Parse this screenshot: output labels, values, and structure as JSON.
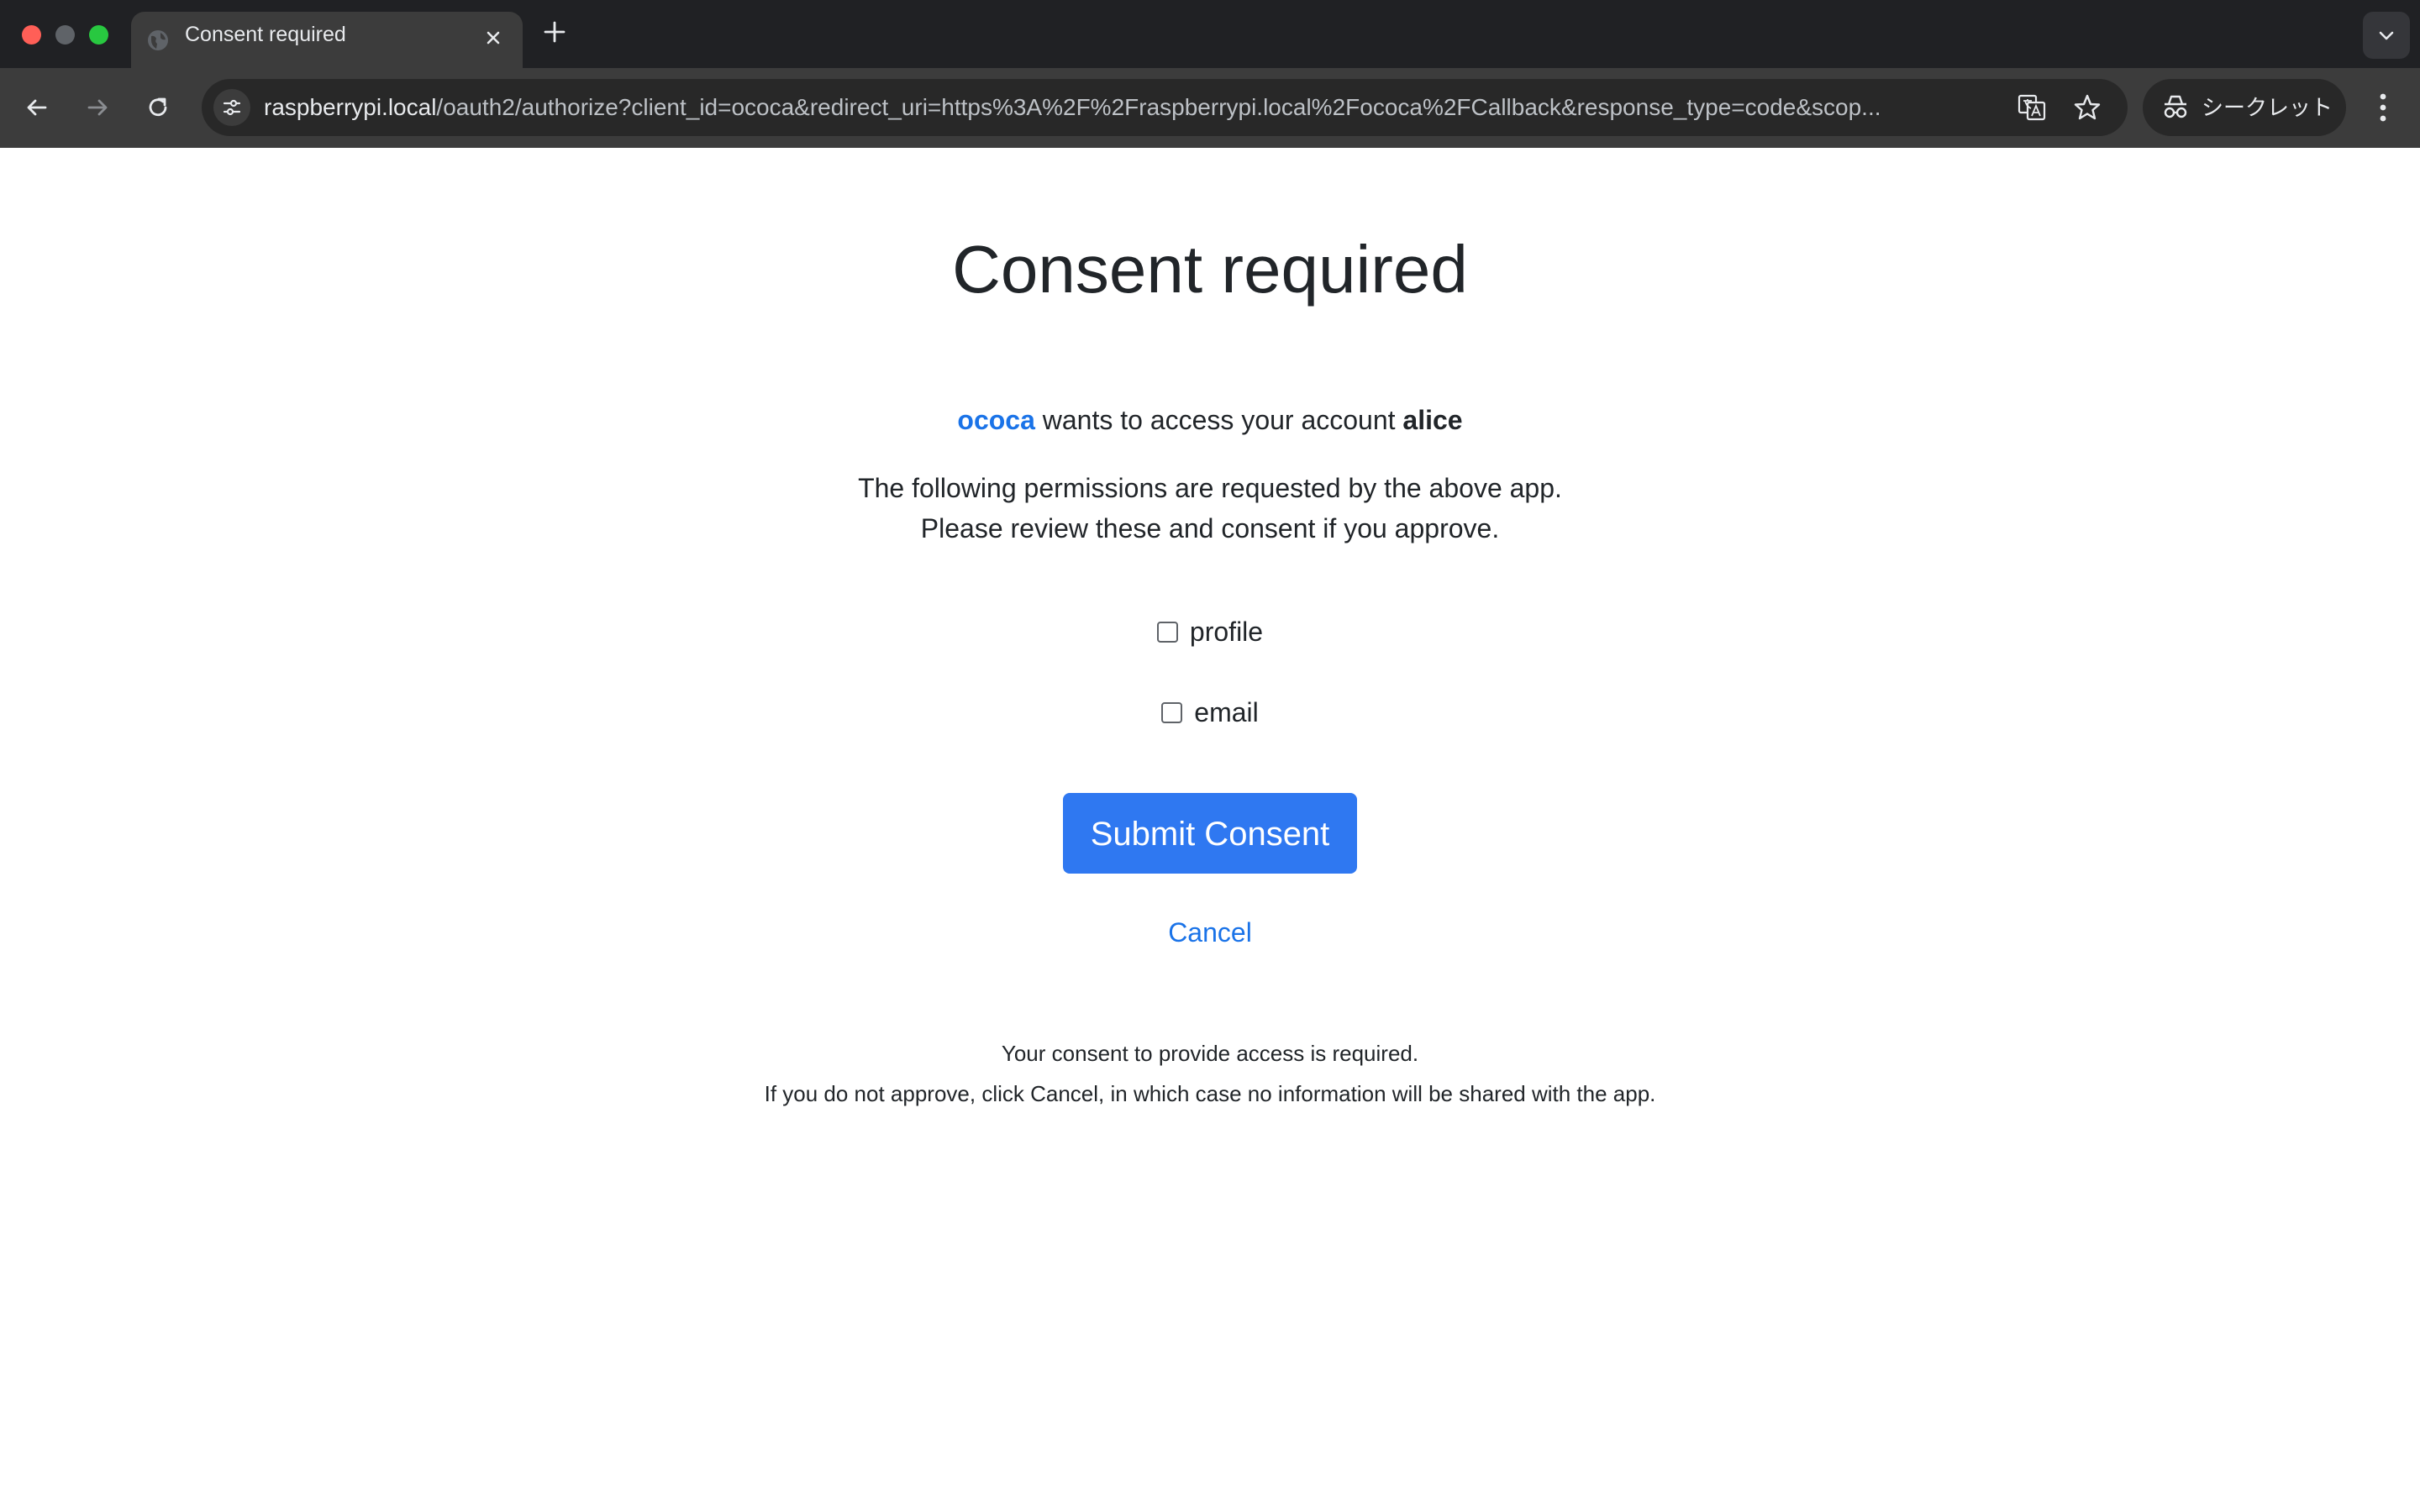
{
  "browser": {
    "tab_title": "Consent required",
    "url_host": "raspberrypi.local",
    "url_path": "/oauth2/authorize?client_id=ococa&redirect_uri=https%3A%2F%2Fraspberrypi.local%2Fococa%2FCallback&response_type=code&scop...",
    "incognito_label": "シークレット"
  },
  "page": {
    "title": "Consent required",
    "client_name": "ococa",
    "request_text": " wants to access your account ",
    "account_name": "alice",
    "permissions_intro_line1": "The following permissions are requested by the above app.",
    "permissions_intro_line2": "Please review these and consent if you approve.",
    "scopes": [
      {
        "label": "profile",
        "checked": false
      },
      {
        "label": "email",
        "checked": false
      }
    ],
    "submit_label": "Submit Consent",
    "cancel_label": "Cancel",
    "footnote_line1": "Your consent to provide access is required.",
    "footnote_line2": "If you do not approve, click Cancel, in which case no information will be shared with the app."
  },
  "colors": {
    "accent": "#1a73e8",
    "button": "#2f78f1",
    "chrome_dark": "#202124"
  }
}
